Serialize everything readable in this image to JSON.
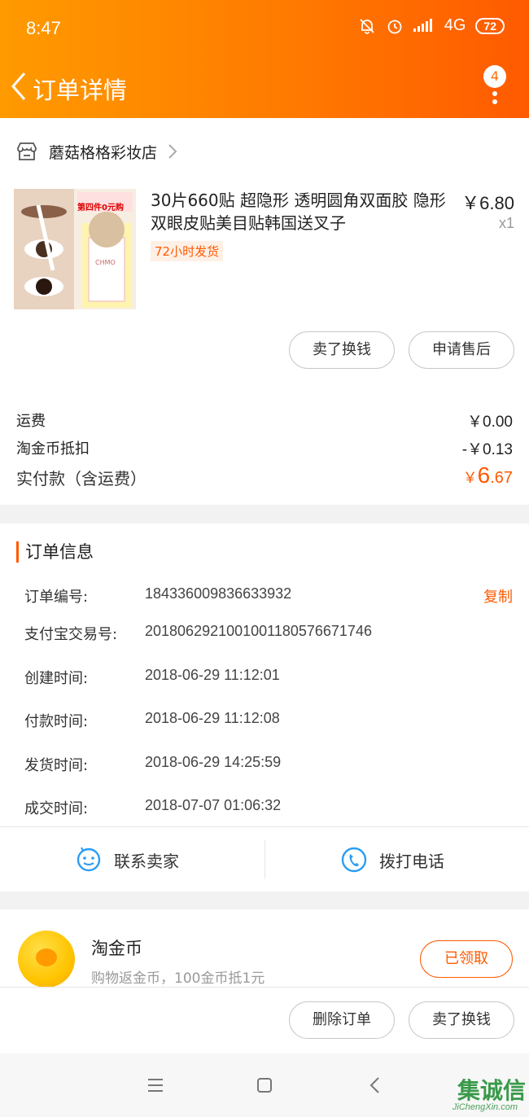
{
  "status_bar": {
    "time": "8:47",
    "network": "4G",
    "battery": "72"
  },
  "header": {
    "title": "订单详情",
    "badge_count": "4"
  },
  "shop": {
    "name": "蘑菇格格彩妆店"
  },
  "product": {
    "title": "30片660贴 超隐形 透明圆角双面胶 隐形双眼皮贴美目贴韩国送叉子",
    "price": "￥6.80",
    "qty": "x1",
    "ship_tag": "72小时发货",
    "img_promo": "第四件0元购",
    "img_brand": "CHMO"
  },
  "item_actions": {
    "sell_label": "卖了换钱",
    "after_sale_label": "申请售后"
  },
  "fees": {
    "shipping_label": "运费",
    "shipping_value": "￥0.00",
    "coin_label": "淘金币抵扣",
    "coin_value": "-￥0.13",
    "paid_label": "实付款（含运费）",
    "paid_currency": "￥",
    "paid_int": "6",
    "paid_dec": ".67"
  },
  "order_info": {
    "heading": "订单信息",
    "copy_label": "复制",
    "rows": [
      {
        "label": "订单编号:",
        "value": "184336009836633932"
      },
      {
        "label": "支付宝交易号:",
        "value": "2018062921001001180576671746"
      },
      {
        "label": "创建时间:",
        "value": "2018-06-29 11:12:01"
      },
      {
        "label": "付款时间:",
        "value": "2018-06-29 11:12:08"
      },
      {
        "label": "发货时间:",
        "value": "2018-06-29 14:25:59"
      },
      {
        "label": "成交时间:",
        "value": "2018-07-07 01:06:32"
      }
    ]
  },
  "contact": {
    "seller_label": "联系卖家",
    "phone_label": "拨打电话"
  },
  "coin": {
    "title": "淘金币",
    "subtitle": "购物返金币，100金币抵1元",
    "claim_label": "已领取"
  },
  "bottom_actions": {
    "delete_label": "删除订单",
    "sell_label": "卖了换钱"
  },
  "watermark": {
    "text": "集诚信",
    "sub": "JiChengXin.com"
  },
  "colors": {
    "accent": "#ff5a00",
    "header_start": "#ff9a00",
    "header_end": "#ff5a00"
  }
}
